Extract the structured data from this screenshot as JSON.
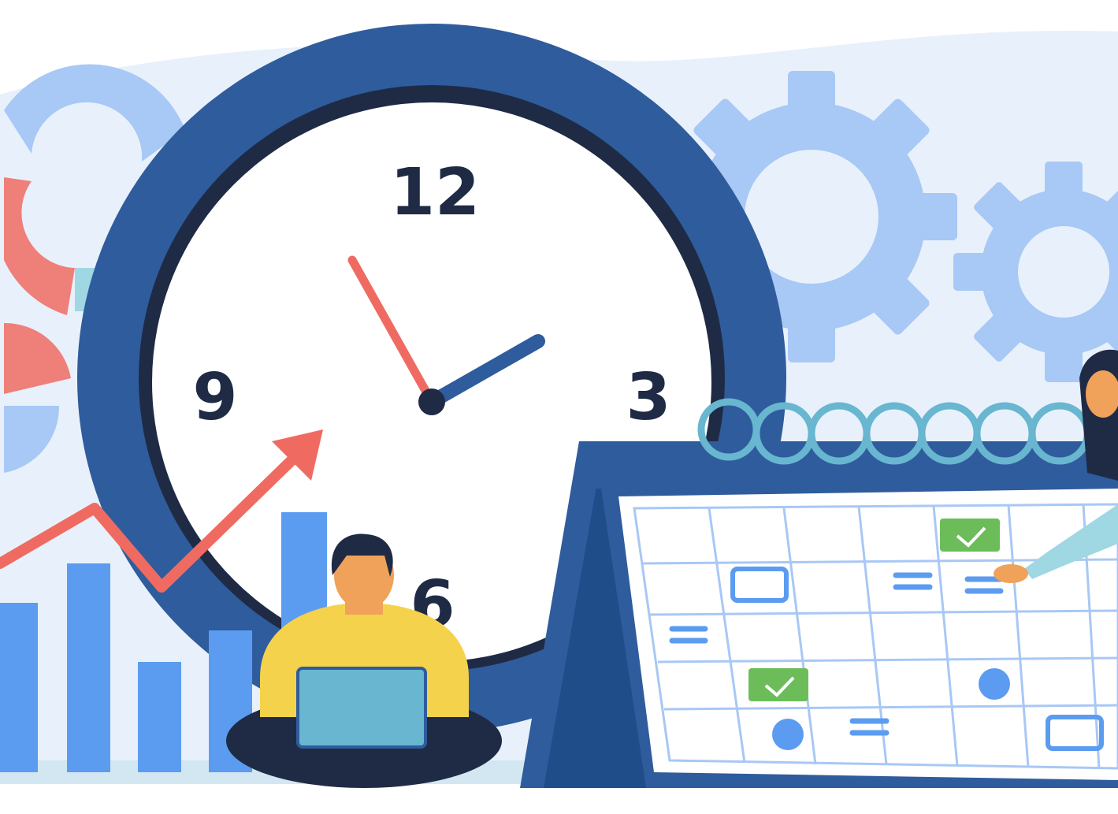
{
  "illustration": {
    "clock": {
      "numerals": {
        "twelve": "12",
        "three": "3",
        "six": "6",
        "nine": "9"
      }
    },
    "colors": {
      "background_wash": "#e8f1fb",
      "navy": "#2f5c9c",
      "dark_navy": "#1f2b45",
      "light_blue": "#a8c8f5",
      "bar_blue": "#5b9cf0",
      "coral": "#ef6b62",
      "teal": "#68b6d0",
      "green": "#6cbd5a",
      "yellow": "#f5d24c",
      "skin": "#f0a15a"
    },
    "icons": [
      "clock-icon",
      "gear-icon",
      "calendar-icon",
      "bar-chart-icon",
      "donut-chart-icon",
      "trend-arrow-icon",
      "laptop-icon",
      "checkmark-icon"
    ]
  }
}
